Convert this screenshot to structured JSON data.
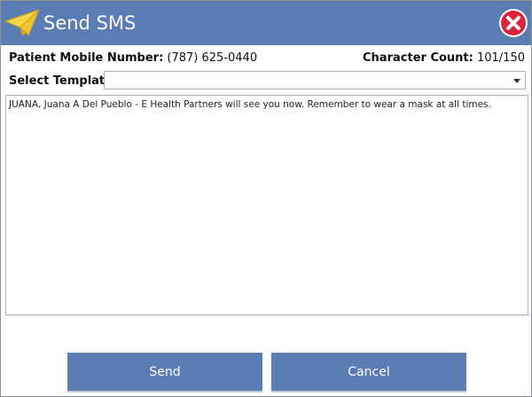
{
  "window": {
    "title": "Send SMS",
    "colors": {
      "titlebar": "#5a7db4",
      "button": "#5a7db4",
      "close": "#d8253c"
    },
    "icons": {
      "app": "paper-plane-icon",
      "close": "close-icon"
    }
  },
  "patient": {
    "mobile_label": "Patient Mobile Number:",
    "mobile_value": "(787) 625-0440"
  },
  "char_count": {
    "label": "Character Count:",
    "value": "101/150"
  },
  "template": {
    "label": "Select Template:",
    "selected": ""
  },
  "message": {
    "text": "JUANA, Juana A Del Pueblo - E Health Partners will see you now. Remember to wear a mask at all times."
  },
  "buttons": {
    "send": "Send",
    "cancel": "Cancel"
  }
}
